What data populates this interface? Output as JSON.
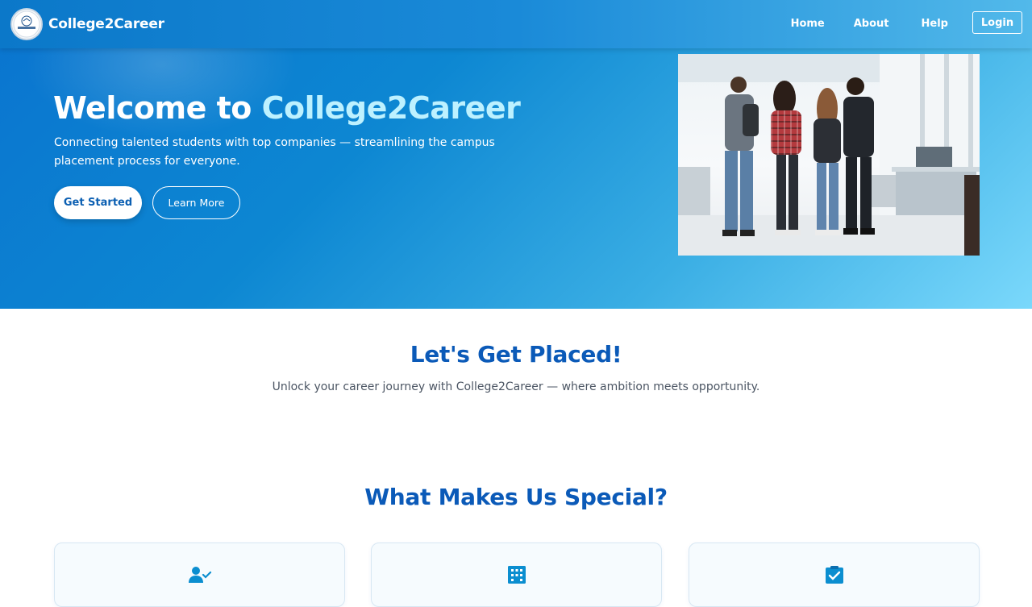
{
  "brand": {
    "name": "College2Career",
    "logo_icon": "college2career-logo-icon",
    "logo_text": "College2Career"
  },
  "nav": {
    "links": [
      {
        "label": "Home"
      },
      {
        "label": "About"
      },
      {
        "label": "Help"
      }
    ],
    "login_label": "Login"
  },
  "hero": {
    "title_prefix": "Welcome to ",
    "title_accent": "College2Career",
    "subtitle": "Connecting talented students with top companies — streamlining the campus placement process for everyone.",
    "primary_cta": "Get Started",
    "secondary_cta": "Learn More"
  },
  "placed": {
    "title": "Let's Get Placed!",
    "subtitle": "Unlock your career journey with College2Career — where ambition meets opportunity."
  },
  "features": {
    "title": "What Makes Us Special?",
    "cards": [
      {
        "icon": "user-check-icon"
      },
      {
        "icon": "building-icon"
      },
      {
        "icon": "clipboard-check-icon"
      }
    ]
  },
  "colors": {
    "primary": "#0b5ab8",
    "hero_start": "#0a74cf",
    "hero_end": "#7ad8fb",
    "accent_text": "#bdf1ff",
    "icon": "#0b8ed0"
  }
}
